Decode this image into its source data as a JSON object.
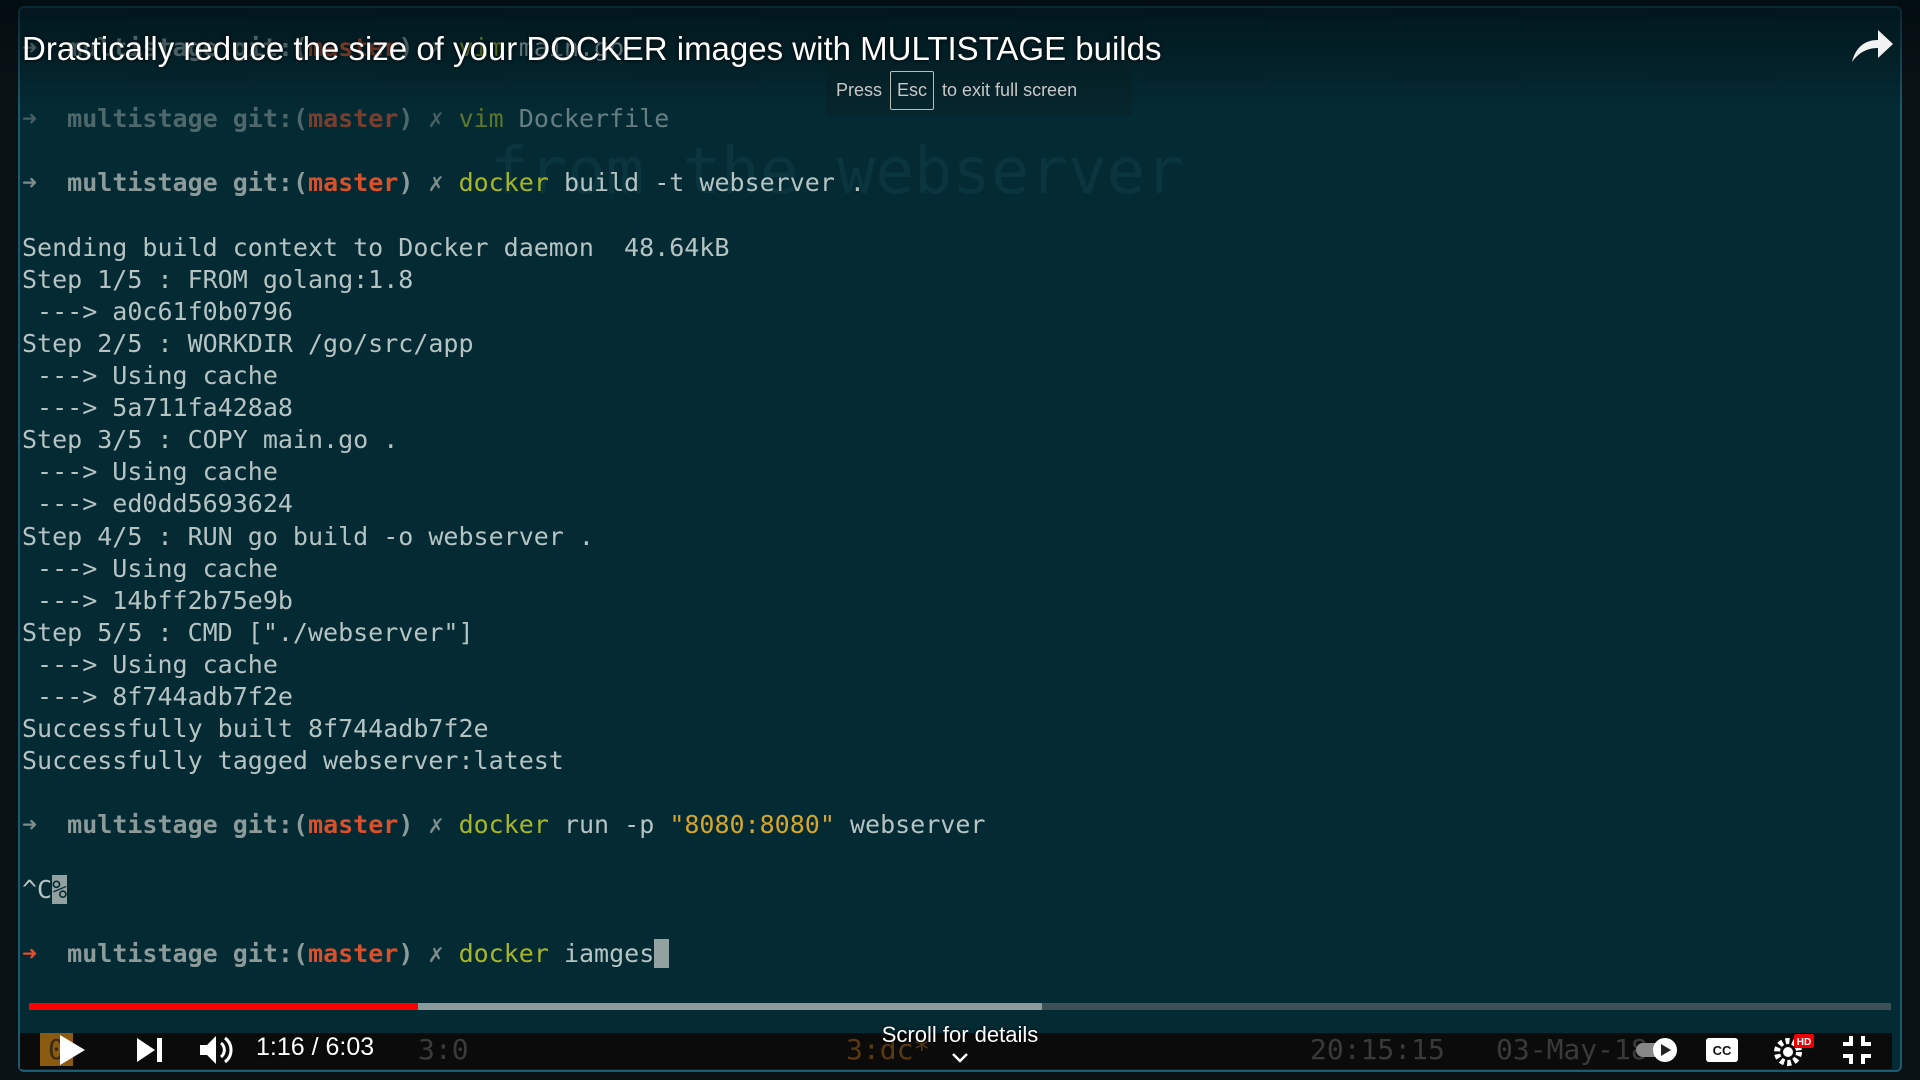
{
  "video": {
    "title": "Drastically reduce the size of your DOCKER images with MULTISTAGE builds",
    "current_time": "1:16",
    "duration": "6:03",
    "time_display": "1:16 / 6:03",
    "played_fraction": 0.209,
    "buffered_fraction": 0.544,
    "scroll_hint": "Scroll for details"
  },
  "toast": {
    "press": "Press",
    "key": "Esc",
    "rest": "to exit full screen"
  },
  "watermark": "from the webserver",
  "prompt": {
    "arrow": "➜",
    "dir": "multistage",
    "git": "git:(",
    "branch": "master",
    "close": ")",
    "dirty": "✗"
  },
  "terminal": {
    "cmd1": "vim",
    "cmd1_arg": "main.go",
    "cmd2": "vim",
    "cmd2_arg": "Dockerfile",
    "cmd3": "docker",
    "cmd3_arg": "build -t webserver .",
    "lines": [
      "Sending build context to Docker daemon  48.64kB",
      "Step 1/5 : FROM golang:1.8",
      " ---> a0c61f0b0796",
      "Step 2/5 : WORKDIR /go/src/app",
      " ---> Using cache",
      " ---> 5a711fa428a8",
      "Step 3/5 : COPY main.go .",
      " ---> Using cache",
      " ---> ed0dd5693624",
      "Step 4/5 : RUN go build -o webserver .",
      " ---> Using cache",
      " ---> 14bff2b75e9b",
      "Step 5/5 : CMD [\"./webserver\"]",
      " ---> Using cache",
      " ---> 8f744adb7f2e",
      "Successfully built 8f744adb7f2e",
      "Successfully tagged webserver:latest"
    ],
    "cmd4": "docker",
    "cmd4_a": "run -p",
    "cmd4_q": "\"8080:8080\"",
    "cmd4_b": "webserver",
    "interrupt": "^C",
    "interrupt_mark": "%",
    "cmd5": "docker",
    "cmd5_arg": "iamges"
  },
  "tmux": {
    "win0": "0",
    "win1": "3:0",
    "win2": "3:dc*",
    "clock": "20:15:15",
    "date": "03-May-18"
  },
  "colors": {
    "progress": "#ff0000",
    "bg": "#042a33",
    "branch": "#d9502a",
    "command": "#a8b526"
  }
}
